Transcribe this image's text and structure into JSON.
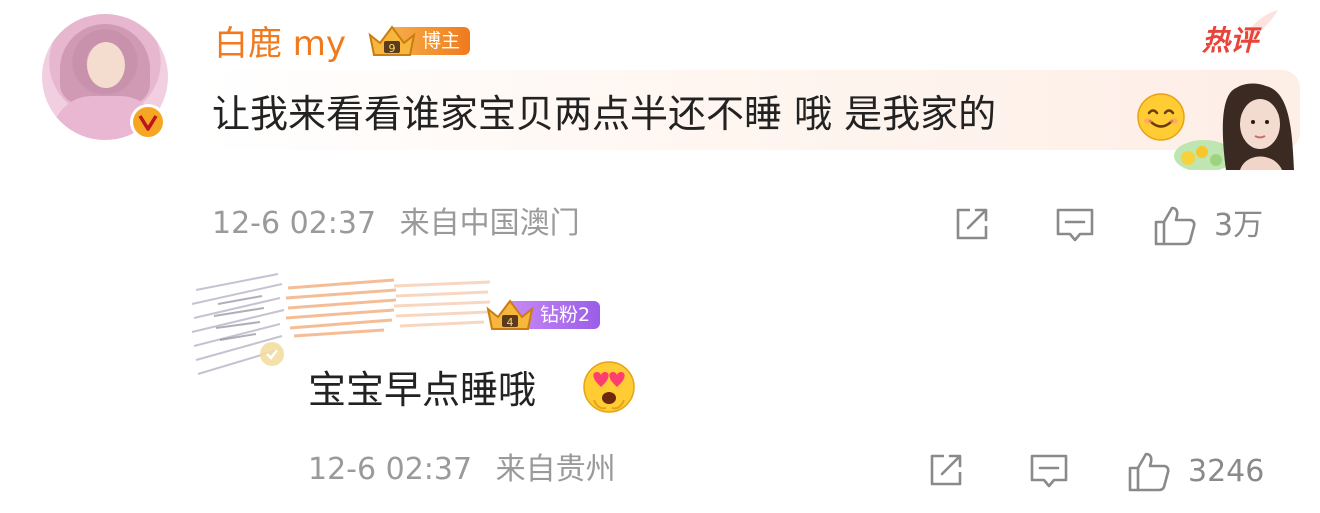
{
  "comment": {
    "author_name": "白鹿 my",
    "author_level": "9",
    "author_badge": "博主",
    "hot_label": "热评",
    "text": "让我来看看谁家宝贝两点半还不睡 哦 是我家的",
    "emoji": "smile-emoji",
    "date_time": "12-6 02:37",
    "location": "来自中国澳门",
    "likes": "3万"
  },
  "reply": {
    "author_level": "4",
    "author_badge": "钻粉2",
    "text": "宝宝早点睡哦",
    "emoji": "heart-eyes-emoji",
    "date_time": "12-6 02:37",
    "location": "来自贵州",
    "likes": "3246"
  },
  "colors": {
    "name_orange": "#f07a1d",
    "hot_red": "#e8443a",
    "meta_gray": "#9a9a9a",
    "badge_orange": "#f07a1d",
    "badge_purple": "#9b5de8",
    "verified_gold": "#f5a623"
  },
  "icons": [
    "share-icon",
    "comment-icon",
    "like-icon",
    "verified-icon",
    "crown-icon"
  ]
}
